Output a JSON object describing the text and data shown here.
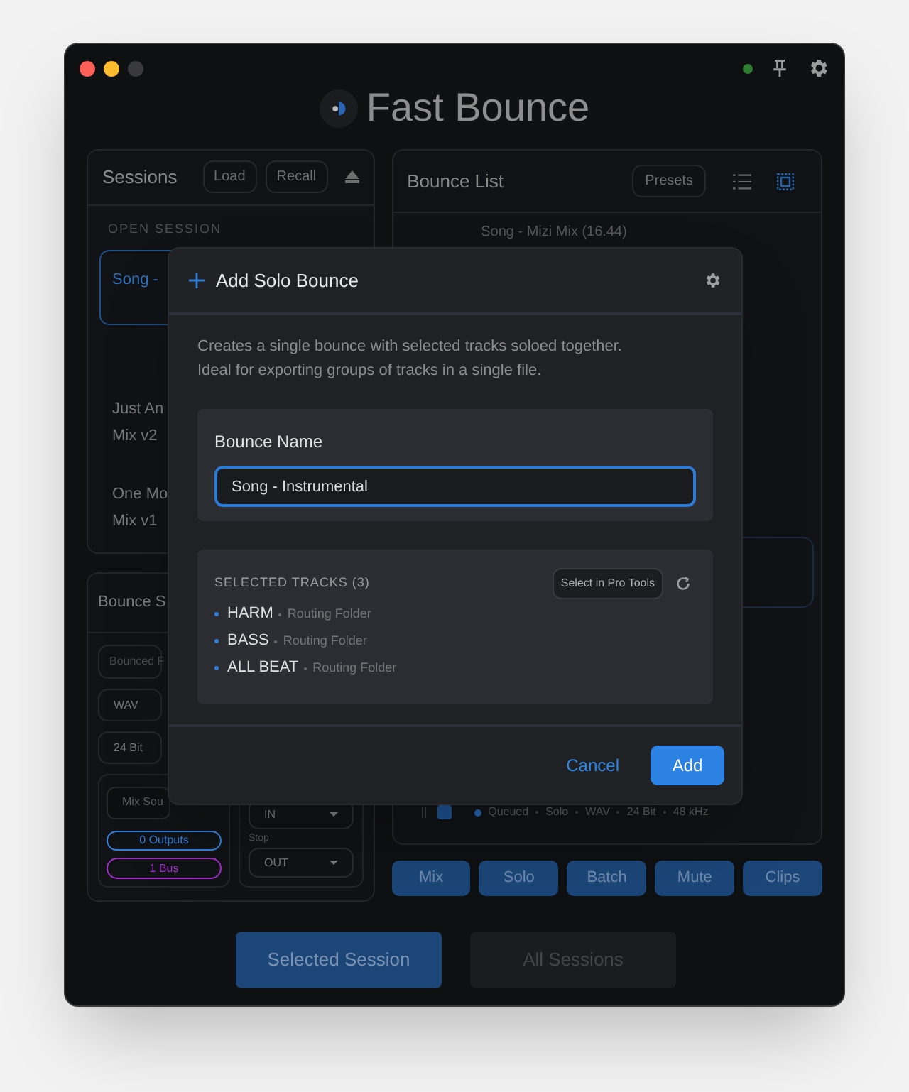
{
  "header": {
    "title": "Fast Bounce",
    "connected": true
  },
  "sessions_panel": {
    "title": "Sessions",
    "buttons": [
      "Load",
      "Recall"
    ],
    "section_label": "OPEN SESSION",
    "items": [
      {
        "name": "Song -",
        "selected": true
      },
      {
        "name": "Just An",
        "subtitle": "Mix v2",
        "selected": false
      },
      {
        "name": "One Mo",
        "subtitle": "Mix v1",
        "selected": false
      }
    ]
  },
  "settings_panel": {
    "title": "Bounce S",
    "filename_placeholder": "Bounced F",
    "format": "WAV",
    "bit_depth": "24 Bit",
    "source_button": "Mix Sou",
    "badges": [
      {
        "label": "0 Outputs",
        "color": "#2f7fd8"
      },
      {
        "label": "1 Bus",
        "color": "#a12ec8"
      }
    ],
    "start_select": "IN",
    "stop_label": "Stop",
    "stop_select": "OUT"
  },
  "bounce_list": {
    "title": "Bounce List",
    "presets_button": "Presets",
    "view_modes": [
      {
        "kind": "list",
        "selected": false
      },
      {
        "kind": "grid",
        "selected": true
      }
    ],
    "top_item": "Song - Mizi Mix (16.44)",
    "queued_meta": [
      "Queued",
      "Solo",
      "WAV",
      "24 Bit",
      "48 kHz"
    ]
  },
  "bounce_types": [
    "Mix",
    "Solo",
    "Batch",
    "Mute",
    "Clips"
  ],
  "scope_buttons": [
    {
      "label": "Selected Session",
      "selected": true
    },
    {
      "label": "All Sessions",
      "selected": false
    }
  ],
  "dialog": {
    "title": "Add Solo Bounce",
    "description_lines": [
      "Creates a single bounce with selected tracks soloed together.",
      "Ideal for exporting groups of tracks in a single file."
    ],
    "name_field": {
      "label": "Bounce Name",
      "value": "Song - Instrumental"
    },
    "tracks": {
      "heading": "SELECTED TRACKS (3)",
      "select_button": "Select in Pro Tools",
      "items": [
        {
          "name": "HARM",
          "type": "Routing Folder"
        },
        {
          "name": "BASS",
          "type": "Routing Folder"
        },
        {
          "name": "ALL BEAT",
          "type": "Routing Folder"
        }
      ]
    },
    "buttons": [
      {
        "label": "Cancel",
        "kind": "text"
      },
      {
        "label": "Add",
        "kind": "primary"
      }
    ]
  }
}
